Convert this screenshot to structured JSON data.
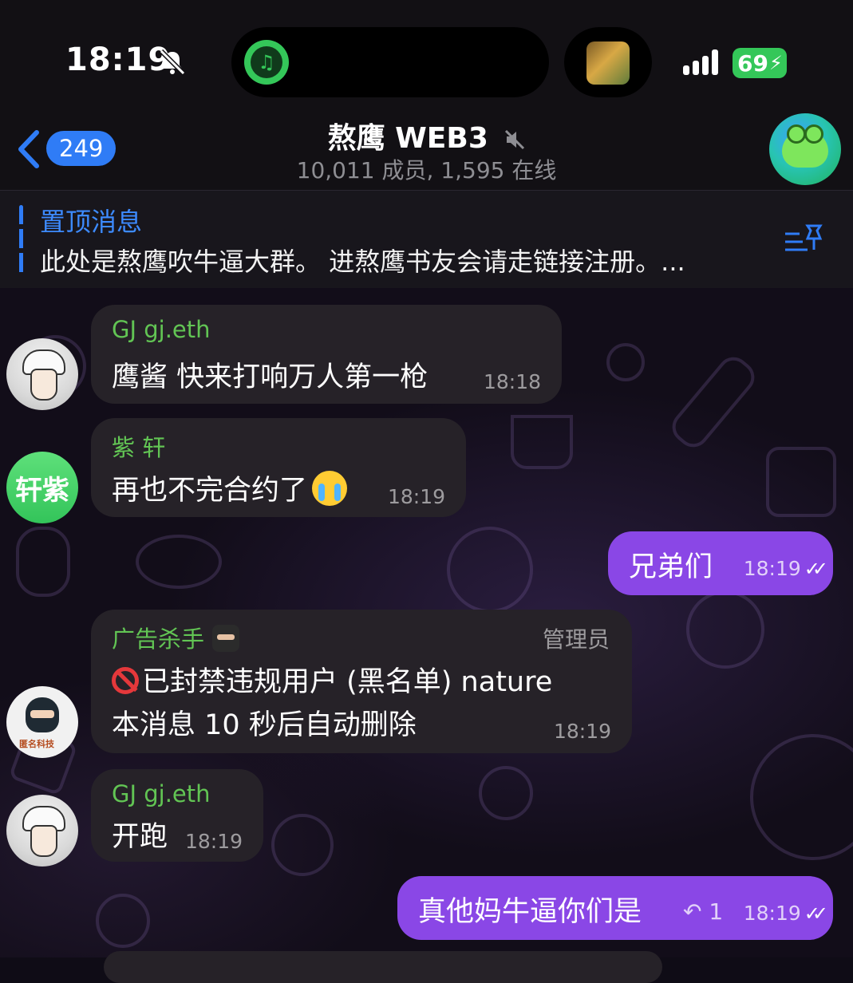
{
  "status_bar": {
    "time": "18:19",
    "battery": "69"
  },
  "header": {
    "back_count": "249",
    "title": "熬鹰 WEB3",
    "subtitle": "10,011 成员, 1,595 在线"
  },
  "pinned": {
    "title": "置顶消息",
    "text": "此处是熬鹰吹牛逼大群。 进熬鹰书友会请走链接注册。..."
  },
  "messages": [
    {
      "sender": "GJ gj.eth",
      "text": "鹰酱 快来打响万人第一枪",
      "time": "18:18",
      "sender_color": "#62c554"
    },
    {
      "sender": "紫 轩",
      "text": "再也不完合约了",
      "time": "18:19",
      "sender_color": "#62c554",
      "avatar_text": "轩紫"
    },
    {
      "text": "兄弟们",
      "time": "18:19",
      "outgoing": true
    },
    {
      "sender": "广告杀手",
      "role": "管理员",
      "line1": "已封禁违规用户 (黑名单) nature",
      "line2": "本消息 10 秒后自动删除",
      "time": "18:19",
      "sender_color": "#62c554",
      "avatar_logo": "匿名科技"
    },
    {
      "sender": "GJ gj.eth",
      "text": "开跑",
      "time": "18:19",
      "sender_color": "#62c554"
    },
    {
      "text": "真他妈牛逼你们是",
      "time": "18:19",
      "reply_count": "1",
      "outgoing": true
    }
  ],
  "colors": {
    "accent": "#2f7cf6",
    "outgoing_bubble": "#8a47e6",
    "incoming_bubble": "#262228",
    "sender_green": "#62c554",
    "battery_green": "#34c759"
  },
  "icons": [
    "bell-slash-icon",
    "music-icon",
    "signal-icon",
    "battery-icon",
    "back-arrow-icon",
    "mute-icon",
    "pin-list-icon",
    "ban-icon",
    "crying-emoji-icon",
    "ninja-emoji-icon",
    "reply-icon",
    "double-check-icon"
  ]
}
